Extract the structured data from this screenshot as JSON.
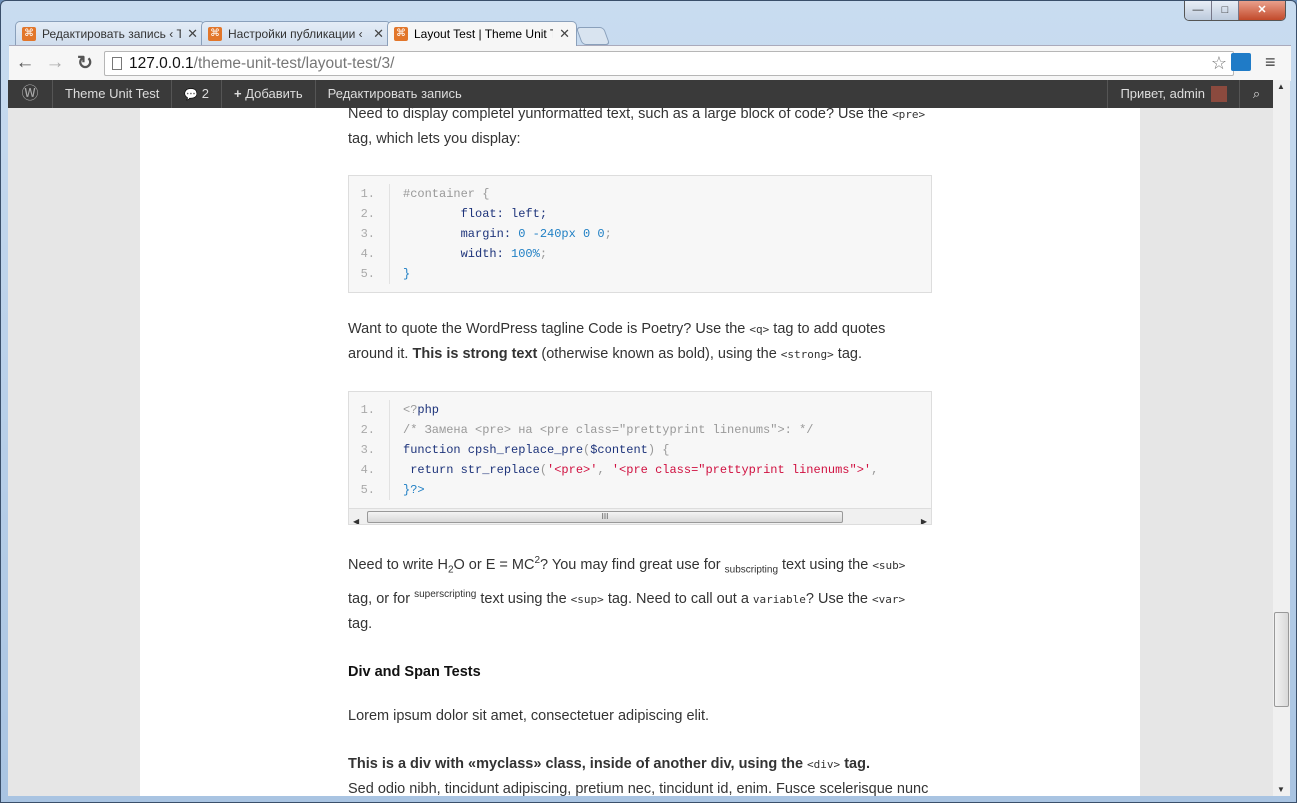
{
  "window": {
    "minimize": "—",
    "maximize": "□",
    "close": "✕"
  },
  "tabs": [
    {
      "title": "Редактировать запись ‹ T",
      "close": "✕"
    },
    {
      "title": "Настройки публикации ‹",
      "close": "✕"
    },
    {
      "title": "Layout Test | Theme Unit T",
      "close": "✕"
    }
  ],
  "toolbar": {
    "back": "←",
    "forward": "→",
    "reload": "↻",
    "url_host": "127.0.0.1",
    "url_path": "/theme-unit-test/layout-test/3/",
    "star": "☆",
    "menu": "≡"
  },
  "adminbar": {
    "logo": "Ⓦ",
    "site": "Theme Unit Test",
    "comments_icon": "💬",
    "comments": "2",
    "add_icon": "+",
    "add": "Добавить",
    "edit": "Редактировать запись",
    "greeting": "Привет, admin",
    "search": "⌕"
  },
  "article": {
    "p1a": "Need to display completel yunformatted text, such as a large block of code? Use the ",
    "p1code": "<pre>",
    "p1b": " tag, which lets you display:",
    "code1": [
      [
        [
          "#container {",
          "c-com"
        ]
      ],
      [
        [
          "        float: left;",
          "c-pln"
        ]
      ],
      [
        [
          "        margin: ",
          "c-pln"
        ],
        [
          "0 -240px 0 0",
          "c-lit"
        ],
        [
          ";",
          "c-pun"
        ]
      ],
      [
        [
          "        width: ",
          "c-pln"
        ],
        [
          "100%",
          "c-lit"
        ],
        [
          ";",
          "c-pun"
        ]
      ],
      [
        [
          "}",
          "c-lit"
        ]
      ]
    ],
    "p2a": "Want to quote the WordPress tagline Code is Poetry? Use the ",
    "p2code": "<q>",
    "p2b": " tag to add quotes around it. ",
    "p2strong": "This is strong text",
    "p2c": " (otherwise known as bold), using the ",
    "p2code2": "<strong>",
    "p2d": " tag.",
    "code2": [
      [
        [
          "<?",
          "c-com"
        ],
        [
          "php",
          "c-kw"
        ]
      ],
      [
        [
          "/* Замена <pre> на <pre class=\"prettyprint linenums\">: */",
          "c-com"
        ]
      ],
      [
        [
          "function cpsh_replace_pre",
          "c-kw"
        ],
        [
          "(",
          "c-pun"
        ],
        [
          "$content",
          "c-pln"
        ],
        [
          ") {",
          "c-pun"
        ]
      ],
      [
        [
          " return str_replace",
          "c-kw"
        ],
        [
          "(",
          "c-pun"
        ],
        [
          "'<pre>'",
          "c-str"
        ],
        [
          ", ",
          "c-pun"
        ],
        [
          "'<pre class=\"prettyprint linenums\">'",
          "c-str"
        ],
        [
          ",",
          "c-pun"
        ]
      ],
      [
        [
          "}?>",
          "c-lit"
        ]
      ]
    ],
    "scroll_grip": "III",
    "p3": {
      "a": "Need to write H",
      "sub2": "2",
      "b": "O or E = MC",
      "sup2": "2",
      "c": "? You may find great use for ",
      "subtxt": "subscripting",
      "d": " text using the ",
      "code_sub": "<sub>",
      "e": " tag, or for ",
      "suptxt": "superscripting",
      "f": " text using the ",
      "code_sup": "<sup>",
      "g": " tag. Need to call out a ",
      "var": "variable",
      "h": "? Use the ",
      "code_var": "<var>",
      "i": " tag."
    },
    "h_div": "Div and Span Tests",
    "lorem": "Lorem ipsum dolor sit amet, consectetuer adipiscing elit.",
    "div_strong_a": "This is a div with «myclass» class, inside of another div, using the ",
    "div_code": "<div>",
    "div_strong_b": " tag.",
    "div_text": "Sed odio nibh, tincidunt adipiscing, pretium nec, tincidunt id, enim. Fusce scelerisque nunc vitae nisl."
  }
}
